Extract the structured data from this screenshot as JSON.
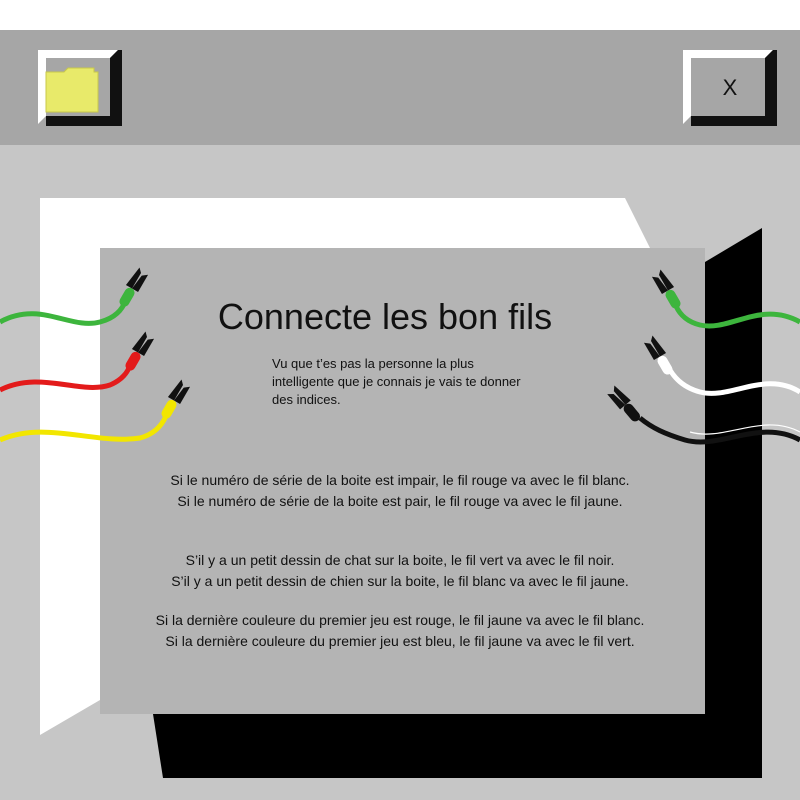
{
  "window": {
    "close_label": "X"
  },
  "game": {
    "title": "Connecte les bon fils",
    "subtitle": "Vu que t’es pas la personne la plus intelligente que je connais je vais te donner des indices.",
    "rule_groups": [
      {
        "lines": [
          "Si le numéro de série de la boite est impair, le fil rouge va avec le fil blanc.",
          "Si le numéro de série de la boite est pair, le fil rouge va avec le fil jaune."
        ]
      },
      {
        "lines": [
          "S’il y a un petit dessin de chat sur la boite, le fil vert va avec le fil noir.",
          "S’il y a un petit dessin de chien sur la boite, le fil blanc va avec le fil jaune."
        ]
      },
      {
        "lines": [
          "Si la dernière couleure du premier jeu est rouge, le fil jaune va avec le fil blanc.",
          "Si la dernière couleure du premier jeu est bleu, le fil jaune va avec le fil vert."
        ]
      }
    ]
  },
  "wires": {
    "left": [
      {
        "name": "wire-green",
        "color": "#3db53d"
      },
      {
        "name": "wire-red",
        "color": "#e31b1b"
      },
      {
        "name": "wire-yellow",
        "color": "#f2e600"
      }
    ],
    "right": [
      {
        "name": "wire-green",
        "color": "#3db53d"
      },
      {
        "name": "wire-white",
        "color": "#ffffff"
      },
      {
        "name": "wire-black",
        "color": "#111111"
      }
    ]
  },
  "icons": {
    "folder": "folder-icon",
    "close": "close-icon",
    "clip": "alligator-clip-icon"
  },
  "colors": {
    "titlebar": "#a6a6a6",
    "window_body": "#c6c6c6",
    "panel": "#b4b4b4",
    "folder": "#e8ea6a"
  }
}
